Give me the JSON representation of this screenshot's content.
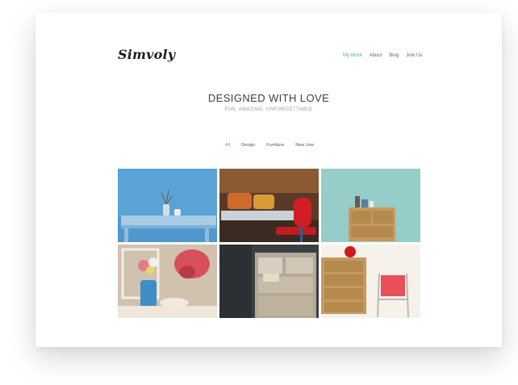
{
  "brand": {
    "logo_text": "Simvoly"
  },
  "nav": {
    "items": [
      {
        "label": "My Work",
        "active": true
      },
      {
        "label": "About",
        "active": false
      },
      {
        "label": "Blog",
        "active": false
      },
      {
        "label": "Join Us",
        "active": false
      }
    ]
  },
  "hero": {
    "title": "DESIGNED WITH LOVE",
    "subtitle": "FUN. AMAZING. UNFORGETTABLE"
  },
  "filters": {
    "items": [
      {
        "label": "All",
        "active": true
      },
      {
        "label": "Design",
        "active": false
      },
      {
        "label": "Furniture",
        "active": false
      },
      {
        "label": "New Line",
        "active": false
      }
    ]
  },
  "gallery": {
    "items": [
      {
        "name": "blue-table-vase-photo"
      },
      {
        "name": "red-chair-cafe-photo"
      },
      {
        "name": "wooden-drawer-teal-wall-photo"
      },
      {
        "name": "flowers-red-hat-chair-photo"
      },
      {
        "name": "rustic-wooden-furniture-photo"
      },
      {
        "name": "dresser-apple-folding-chair-photo"
      }
    ]
  },
  "colors": {
    "accent": "#4bb3a6",
    "text": "#3f3f3f"
  }
}
